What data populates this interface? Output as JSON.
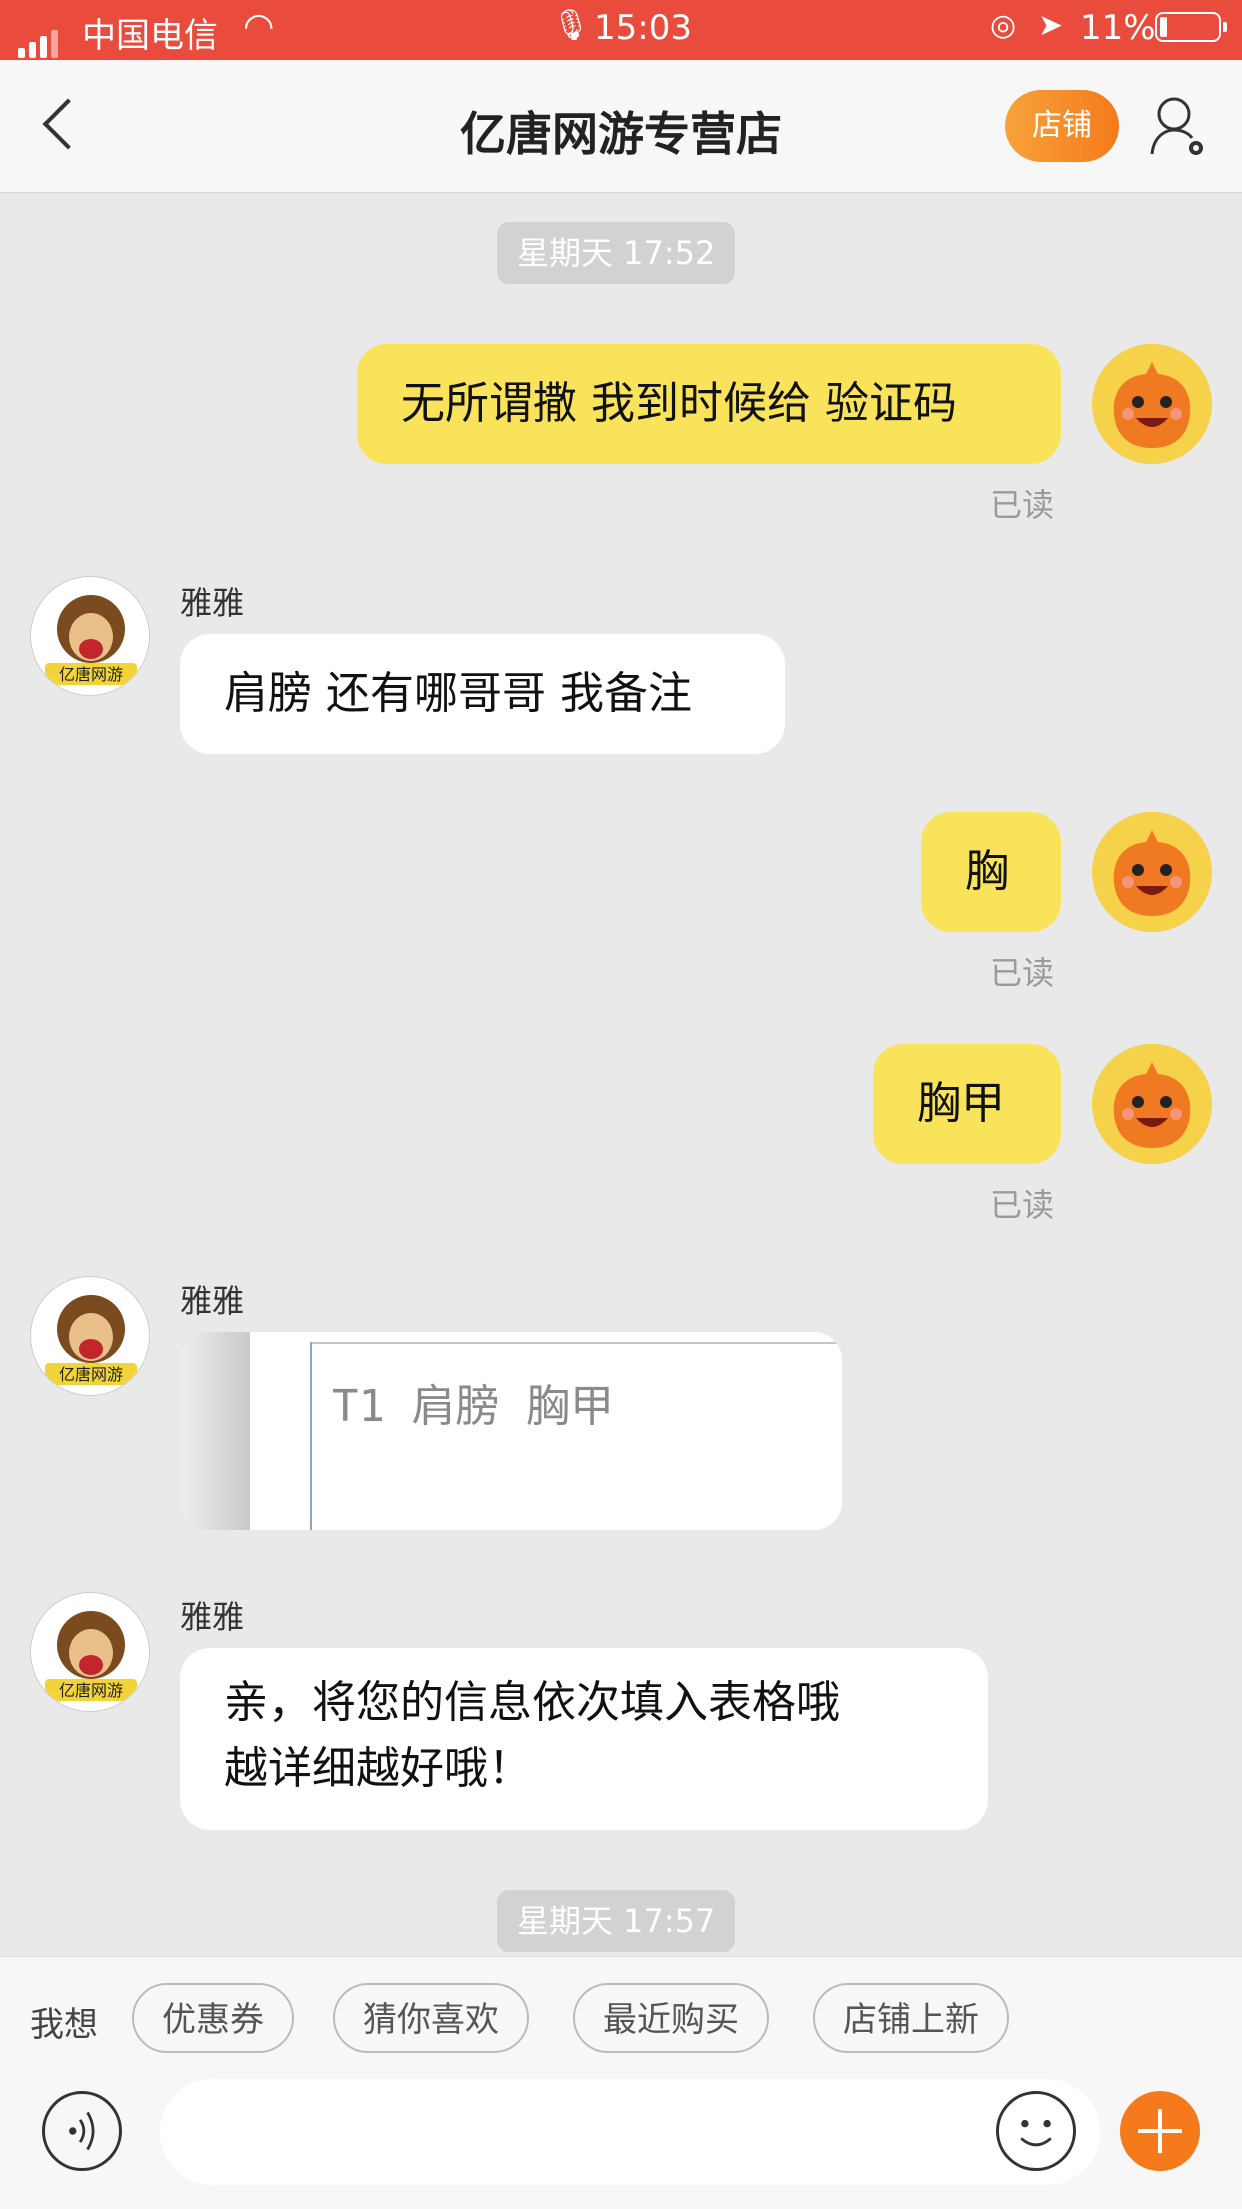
{
  "status_bar": {
    "carrier": "中国电信",
    "time": "15:03",
    "battery": "11%"
  },
  "header": {
    "title": "亿唐网游专营店",
    "shop_button": "店铺"
  },
  "messages": {
    "ts1": "星期天 17:52",
    "m1": "无所谓撒 我到时候给 验证码",
    "read1": "已读",
    "sender1": "雅雅",
    "m2": "肩膀 还有哪哥哥 我备注",
    "m3": "胸",
    "read2": "已读",
    "m4": "胸甲",
    "read3": "已读",
    "sender2": "雅雅",
    "img_text": "T1 肩膀 胸甲",
    "sender3": "雅雅",
    "m5_line1": "亲，将您的信息依次填入表格哦",
    "m5_line2": "越详细越好哦！",
    "ts2": "星期天 17:57"
  },
  "quick_bar": {
    "label": "我想",
    "chips": [
      "优惠券",
      "猜你喜欢",
      "最近购买",
      "店铺上新"
    ]
  },
  "colors": {
    "status_red": "#e94b3c",
    "accent_orange": "#f57a1c",
    "bubble_yellow": "#f8e35a"
  },
  "icons": [
    "back-icon",
    "user-settings-icon",
    "voice-icon",
    "emoji-icon",
    "plus-icon"
  ]
}
